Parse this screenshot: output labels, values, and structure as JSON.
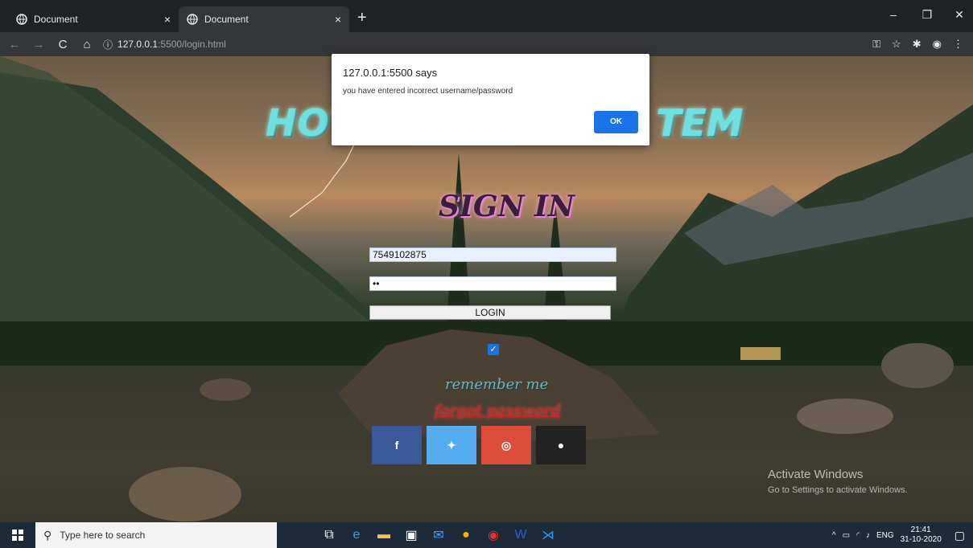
{
  "browser": {
    "tabs": [
      {
        "title": "Document",
        "close": "×"
      },
      {
        "title": "Document",
        "close": "×"
      }
    ],
    "new_tab": "+",
    "window_controls": {
      "minimize": "–",
      "restore": "❐",
      "close": "✕"
    },
    "address": {
      "host": "127.0.0.1",
      "path": ":5500/login.html"
    }
  },
  "page": {
    "title_left": "HOT",
    "title_right": "TEM",
    "signin_heading": "SIGN IN",
    "username_value": "7549102875",
    "password_value": "••",
    "login_label": "LOGIN",
    "remember_label": "remember me",
    "forgot_label": "forgot password",
    "social": [
      {
        "name": "facebook",
        "glyph": "f",
        "color": "#3b5998"
      },
      {
        "name": "twitter",
        "glyph": "✦",
        "color": "#55acee"
      },
      {
        "name": "instagram",
        "glyph": "◎",
        "color": "#dd4b39"
      },
      {
        "name": "github",
        "glyph": "●",
        "color": "#222222"
      }
    ]
  },
  "alert": {
    "origin": "127.0.0.1:5500 says",
    "message": "you have entered incorrect username/password",
    "ok_label": "OK"
  },
  "watermark": {
    "title": "Activate Windows",
    "subtitle": "Go to Settings to activate Windows."
  },
  "taskbar": {
    "search_placeholder": "Type here to search",
    "language": "ENG",
    "time": "21:41",
    "date": "31-10-2020"
  }
}
